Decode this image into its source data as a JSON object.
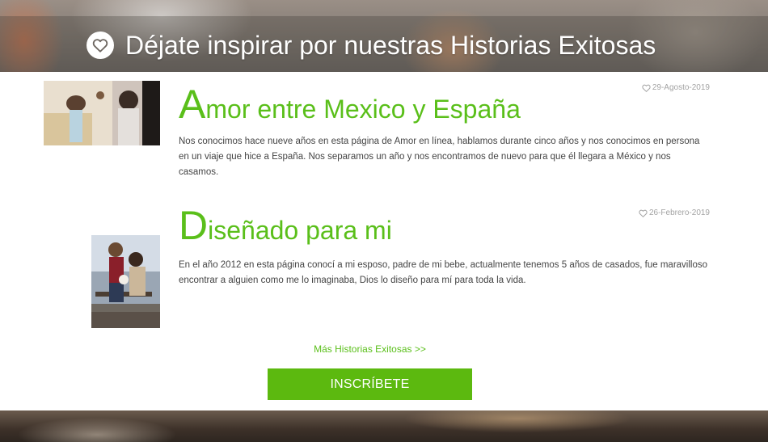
{
  "banner": {
    "title": "Déjate inspirar por nuestras Historias Exitosas",
    "icon": "heart-icon"
  },
  "stories": [
    {
      "title_initial": "A",
      "title_rest": "mor entre Mexico y España",
      "date": "29-Agosto-2019",
      "body": "Nos conocimos hace nueve años en esta página de Amor en línea, hablamos durante cinco años y nos conocimos en persona en un viaje que hice a España. Nos separamos un año y nos encontramos de nuevo para que él llegara a México y nos casamos."
    },
    {
      "title_initial": "D",
      "title_rest": "iseñado para mi",
      "date": "26-Febrero-2019",
      "body": "En el año 2012 en esta página conocí a mi esposo, padre de mi bebe, actualmente tenemos 5 años de casados, fue maravilloso encontrar a alguien como me lo imaginaba, Dios lo diseño para mí para toda la vida."
    }
  ],
  "more_link": "Más Historias Exitosas >>",
  "cta_label": "INSCRÍBETE",
  "colors": {
    "accent": "#5abf1a",
    "button": "#5cb90f",
    "date_gray": "#a3a3a3"
  }
}
